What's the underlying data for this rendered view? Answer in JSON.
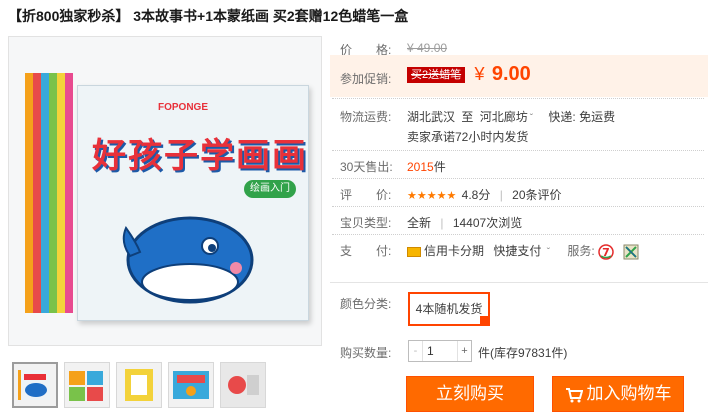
{
  "title": "【折800独家秒杀】 3本故事书+1本蒙纸画 买2套赠12色蜡笔一盒",
  "product_image": {
    "cover_title": "好孩子学画画",
    "cover_subtitle": "绘画入门",
    "cover_logo": "FOPONGE"
  },
  "price": {
    "label": "价　　格:",
    "original": "¥ 49.00"
  },
  "promo": {
    "label": "参加促销:",
    "tag": "买2送蜡笔",
    "currency": "¥",
    "price": "9.00"
  },
  "shipping": {
    "label": "物流运费:",
    "from": "湖北武汉",
    "sep": "至",
    "to": "河北廊坊",
    "delivery": "快递: 免运费",
    "promise": "卖家承诺72小时内发货"
  },
  "sold": {
    "label": "30天售出:",
    "count": "2015",
    "unit": "件"
  },
  "rating": {
    "label": "评　　价:",
    "stars": "★★★★★",
    "score": "4.8分",
    "reviews": "20条评价"
  },
  "type": {
    "label": "宝贝类型:",
    "condition": "全新",
    "views": "14407次浏览"
  },
  "payment": {
    "label": "支　　付:",
    "installment": "信用卡分期",
    "quick": "快捷支付",
    "service_label": "服务:"
  },
  "sku": {
    "label": "颜色分类:",
    "option": "4本随机发货"
  },
  "quantity": {
    "label": "购买数量:",
    "value": "1",
    "dec": "-",
    "inc": "+",
    "unit": "件",
    "stock": "(库存97831件)"
  },
  "buttons": {
    "buy": "立刻购买",
    "cart": "加入购物车"
  },
  "colors": {
    "accent": "#ff4400",
    "button": "#ff6a00",
    "promo_bg": "#fff2e8"
  }
}
